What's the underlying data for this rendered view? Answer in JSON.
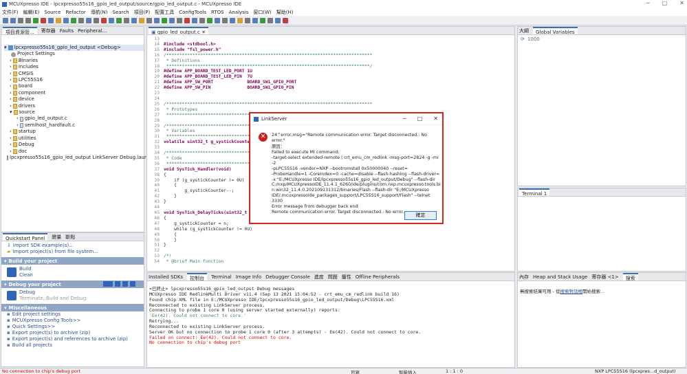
{
  "window": {
    "title": "MCUXpresso IDE - lpcxpresso55s16_gpio_led_output/source/gpio_led_output.c - MCUXpresso IDE",
    "controls": [
      "─",
      "□",
      "✕"
    ]
  },
  "menu": [
    "文件(F)",
    "編輯(E)",
    "Source",
    "Refactor",
    "導航(N)",
    "Search",
    "項目(P)",
    "配置工具",
    "ConfigTools",
    "RTOS",
    "Analysis",
    "窗口(W)",
    "幫助(H)"
  ],
  "project_explorer": {
    "tabs": [
      "項目資源管...",
      "寄存器",
      "Faults",
      "Peripheral..."
    ],
    "root": "lpcxpresso55s16_gpio_led_output <Debug>",
    "items": [
      "Project Settings",
      "Binaries",
      "Includes",
      "CMSIS",
      "LPC55S16",
      "board",
      "component",
      "device",
      "drivers",
      "source"
    ],
    "source_files": [
      "gpio_led_output.c",
      "semihost_hardfault.c"
    ],
    "items_after": [
      "startup",
      "utilities",
      "Debug",
      "doc"
    ],
    "launch": "lpcxpresso55s16_gpio_led_output LinkServer Debug.launch"
  },
  "quickstart": {
    "tabs": [
      "Quickstart Panel",
      "變量",
      "斷點"
    ],
    "import_items": [
      "Import SDK example(s)...",
      "Import project(s) from file system..."
    ],
    "build_header": "Build your project",
    "build_items": [
      "Build",
      "Clean"
    ],
    "debug_header": "Debug your project",
    "debug_items": [
      "Debug",
      "Terminate, Build and Debug"
    ],
    "misc_header": "Miscellaneous",
    "misc_items": [
      "Edit project settings",
      "MCUXpresso Config Tools>>",
      "Quick Settings>>",
      "Export project(s) to archive (zip)",
      "Export project(s) and references to archive (zip)",
      "Build all projects"
    ]
  },
  "editor": {
    "tab": "gpio_led_output.c",
    "lines": [
      {
        "n": "13",
        "t": ""
      },
      {
        "n": "14",
        "t": "#include <stdbool.h>"
      },
      {
        "n": "15",
        "t": "#include \"fsl_power.h\""
      },
      {
        "n": "16",
        "t": "/*******************************************************************************"
      },
      {
        "n": "17",
        "t": " * Definitions"
      },
      {
        "n": "18",
        "t": " ******************************************************************************/"
      },
      {
        "n": "19",
        "t": "#define APP_BOARD_TEST_LED_PORT 1U"
      },
      {
        "n": "20",
        "t": "#define APP_BOARD_TEST_LED_PIN  7U"
      },
      {
        "n": "21",
        "t": "#define APP_SW_PORT             BOARD_SW1_GPIO_PORT"
      },
      {
        "n": "22",
        "t": "#define APP_SW_PIN              BOARD_SW1_GPIO_PIN"
      },
      {
        "n": "23",
        "t": ""
      },
      {
        "n": "24",
        "t": ""
      },
      {
        "n": "25",
        "t": "/*******************************************************************************"
      },
      {
        "n": "26",
        "t": " * Prototypes"
      },
      {
        "n": "27",
        "t": " *************************************"
      },
      {
        "n": "28",
        "t": ""
      },
      {
        "n": "29",
        "t": "/*************************************"
      },
      {
        "n": "30",
        "t": " * Variables"
      },
      {
        "n": "31",
        "t": " *************************************"
      },
      {
        "n": "32",
        "t": "volatile uint32_t g_systickCounter"
      },
      {
        "n": "33",
        "t": ""
      },
      {
        "n": "34",
        "t": "/*************************************"
      },
      {
        "n": "35",
        "t": " * Code"
      },
      {
        "n": "36",
        "t": " *************************************"
      },
      {
        "n": "37",
        "t": "void SysTick_Handler(void)"
      },
      {
        "n": "38",
        "t": "{"
      },
      {
        "n": "39",
        "t": "    if (g_systickCounter != 0U)"
      },
      {
        "n": "40",
        "t": "    {"
      },
      {
        "n": "41",
        "t": "        g_systickCounter--;"
      },
      {
        "n": "42",
        "t": "    }"
      },
      {
        "n": "43",
        "t": "}"
      },
      {
        "n": "44",
        "t": ""
      },
      {
        "n": "45",
        "t": "void SysTick_DelayTicks(uint32_t n"
      },
      {
        "n": "46",
        "t": "{"
      },
      {
        "n": "47",
        "t": "    g_systickCounter = n;"
      },
      {
        "n": "48",
        "t": "    while (g_systickCounter != 0U)"
      },
      {
        "n": "49",
        "t": "    {"
      },
      {
        "n": "50",
        "t": "    }"
      },
      {
        "n": "51",
        "t": "}"
      },
      {
        "n": "52",
        "t": ""
      },
      {
        "n": "53",
        "t": "/*!"
      },
      {
        "n": "54",
        "t": " * @brief Main function"
      }
    ]
  },
  "right_panel": {
    "tabs": [
      "大綱",
      "Global Variables"
    ],
    "refresh_value": "1000",
    "terminal_tab": "Terminal 1"
  },
  "bottom_tabs": [
    "Installed SDKs",
    "控制台",
    "Terminal",
    "Image Info",
    "Debugger Console",
    "進度",
    "問題",
    "屬性",
    "Offline Peripherals"
  ],
  "console": {
    "title": "<已終止> lpcxpresso55s16_gpio_led_output Debug messages",
    "lines": [
      {
        "t": "MCUXpresso IDE RedlinkMulti Driver v11.4 (Sep 13 2021 15:04:52 - crt_emu_cm_redlink build 16)",
        "c": "normal"
      },
      {
        "t": "Found chip XML file in E:/MCUXpresso IDE/lpcxpresso55s16_gpio_led_output/Debug\\LPC55S16.xml",
        "c": "normal"
      },
      {
        "t": "Reconnected to existing LinkServer process.",
        "c": "normal"
      },
      {
        "t": "Connecting to probe 1 core 0 (using server started externally) reports:",
        "c": "normal"
      },
      {
        "t": "'Ee(42). Could not connect to core.'",
        "c": "green"
      },
      {
        "t": "Retrying...",
        "c": "normal"
      },
      {
        "t": "Reconnected to existing LinkServer process.",
        "c": "normal"
      },
      {
        "t": "Server OK but no connection to probe 1 core 0 (after 3 attempts) - Ee(42). Could not connect to core.",
        "c": "normal"
      },
      {
        "t": "Failed on connect: Ee(42). Could not connect to core.",
        "c": "red"
      },
      {
        "t": "No connection to chip's debug port",
        "c": "red"
      }
    ]
  },
  "right_bottom": {
    "tabs": [
      "內存",
      "Heap and Stack Usage",
      "寄存器 <1>",
      "搜索"
    ],
    "text_prefix": "無搜索結果可用 - 從",
    "link": "搜索對話框",
    "text_suffix": "開始搜索..."
  },
  "dialog": {
    "title": "LinkServer",
    "message": "24^error,msg=\"Remote communication error.  Target disconnected.: No error.\"",
    "reason_label": "原因：",
    "details": [
      "Failed to execute MI command:",
      "-target-select extended-remote | crt_emu_cm_redlink -msg-port=2824 -g -mi -2",
      "-pLPC55S16 -vendor=NXP --bootromstall 0x50000040  --reset=",
      "-ProbeHandle=1 -CoreIndex=0 -cache=disable --flash-hashing --flash-driver=",
      "-x \"E:/MCUXpresso IDE/lpcxpresso55s16_gpio_led_output/Debug\" --flash-dir",
      "C:/nxp/MCUXpressoIDE_11.4.1_6260/ide/plugins/com.nxp.mcuxpresso.tools.bi",
      "n.win32_11.4.0.202109131312/binaries/Flash --flash-dir \"E:/MCUXpresso",
      "IDE/.mcuxpressoide_packages_support/LPC55S16_support/Flash\" --telnet 3330",
      "Error message from debugger back end:",
      "Remote communication error.  Target disconnected.: No error."
    ],
    "ok_label": "確定"
  },
  "status": {
    "left": "No connection to chip's debug port",
    "writable": "可寫",
    "insert": "智能插入",
    "position": "1 : 1 : 0",
    "right": "NXP LPC55S16 (lpcxpres...d_output)"
  }
}
